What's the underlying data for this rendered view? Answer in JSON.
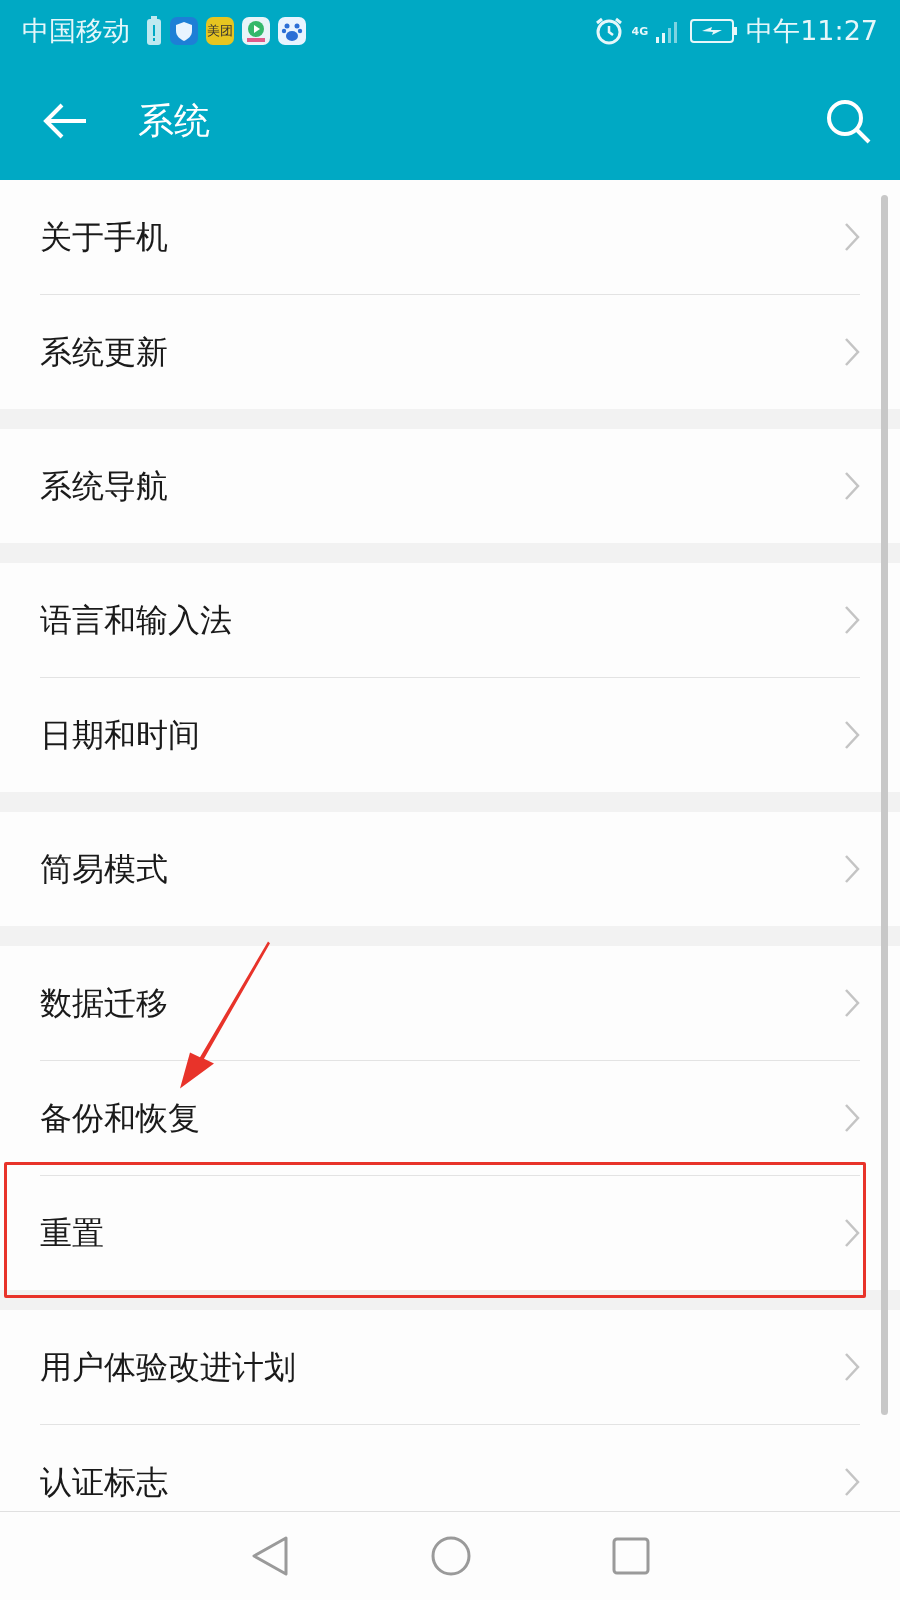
{
  "status_bar": {
    "carrier": "中国移动",
    "app_badge": "美团",
    "network": "4G",
    "time": "中午11:27"
  },
  "header": {
    "title": "系统"
  },
  "groups": [
    {
      "items": [
        {
          "label": "关于手机",
          "highlighted": false
        },
        {
          "label": "系统更新",
          "highlighted": false
        }
      ]
    },
    {
      "items": [
        {
          "label": "系统导航",
          "highlighted": false
        }
      ]
    },
    {
      "items": [
        {
          "label": "语言和输入法",
          "highlighted": false
        },
        {
          "label": "日期和时间",
          "highlighted": false
        }
      ]
    },
    {
      "items": [
        {
          "label": "简易模式",
          "highlighted": false
        }
      ]
    },
    {
      "items": [
        {
          "label": "数据迁移",
          "highlighted": false
        },
        {
          "label": "备份和恢复",
          "highlighted": false
        },
        {
          "label": "重置",
          "highlighted": true
        }
      ]
    },
    {
      "items": [
        {
          "label": "用户体验改进计划",
          "highlighted": false
        },
        {
          "label": "认证标志",
          "highlighted": false
        }
      ]
    }
  ]
}
